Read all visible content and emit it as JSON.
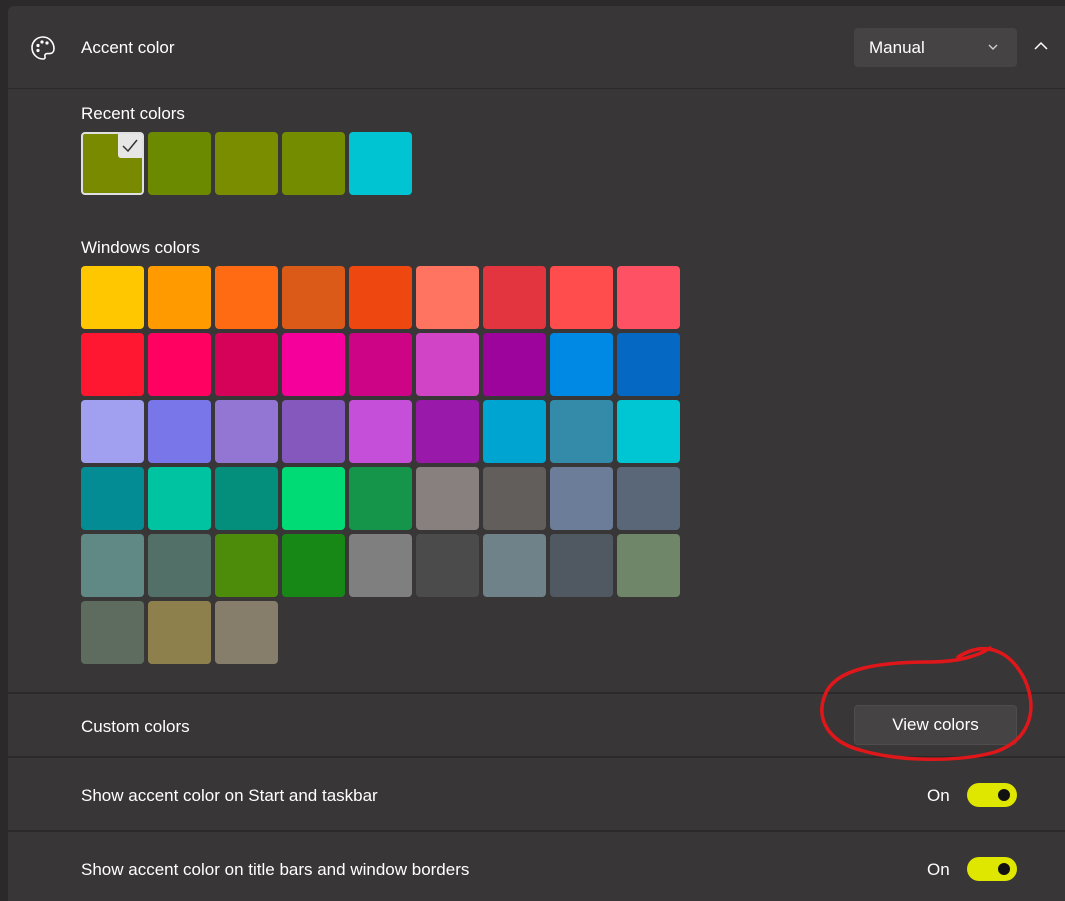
{
  "header": {
    "icon": "palette-icon",
    "title": "Accent color",
    "mode_dropdown": {
      "value": "Manual",
      "icon": "chevron-down-icon"
    },
    "collapse_icon": "chevron-up-icon"
  },
  "recent_colors": {
    "label": "Recent colors",
    "selected_index": 0,
    "swatches": [
      "#7a8a00",
      "#6b8a00",
      "#7a8c00",
      "#738c00",
      "#00c4d2"
    ]
  },
  "windows_colors": {
    "label": "Windows colors",
    "swatches": [
      "#ffc700",
      "#ff9b00",
      "#ff6b13",
      "#dc5a17",
      "#ee4710",
      "#ff7460",
      "#e2353f",
      "#ff4d4d",
      "#ff5164",
      "#ff1731",
      "#ff0161",
      "#d60259",
      "#f5009a",
      "#cd0486",
      "#d244c6",
      "#9c049c",
      "#0088e5",
      "#0568c3",
      "#a09ff0",
      "#7876e8",
      "#9376d4",
      "#8558bd",
      "#c54fd8",
      "#991aaa",
      "#00a4d0",
      "#348aa9",
      "#00c6d3",
      "#048c94",
      "#00c3a2",
      "#038f7c",
      "#00db76",
      "#15954a",
      "#887f7f",
      "#625e5c",
      "#6c7d9a",
      "#596778",
      "#608985",
      "#537068",
      "#4d8c0b",
      "#178816",
      "#7f7f7f",
      "#4b4b4b",
      "#6f828a",
      "#505962",
      "#6f8669",
      "#5d6c5e",
      "#8e804d",
      "#867d6b"
    ]
  },
  "custom_colors": {
    "label": "Custom colors",
    "button_label": "View colors"
  },
  "show_on_start": {
    "label": "Show accent color on Start and taskbar",
    "state_label": "On",
    "on": true
  },
  "show_on_title_bars": {
    "label": "Show accent color on title bars and window borders",
    "state_label": "On",
    "on": true
  },
  "colors": {
    "toggle_on": "#dfe600",
    "annotation": "#e0171a",
    "card": "#383636",
    "background": "#2b2929"
  }
}
